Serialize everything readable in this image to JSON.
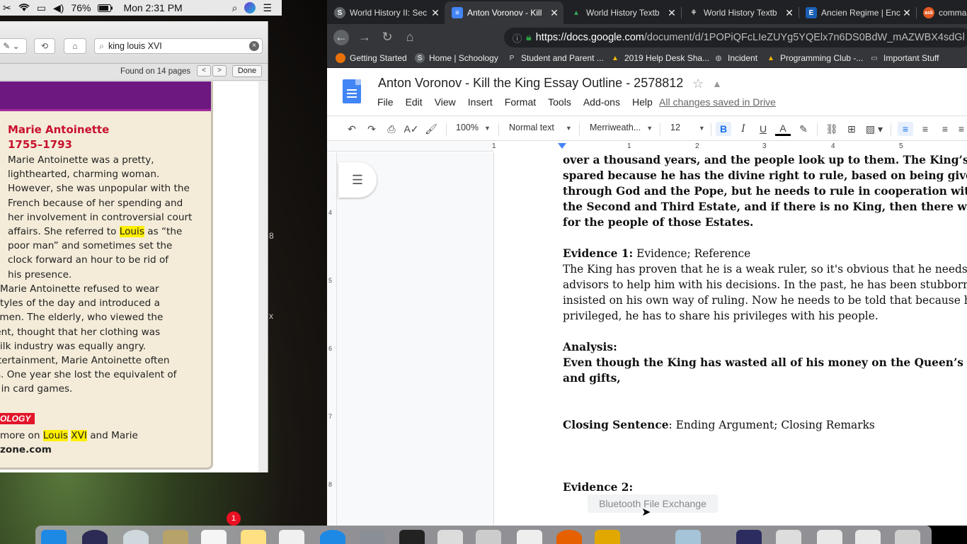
{
  "menubar": {
    "battery": "76%",
    "clock": "Mon 2:31 PM"
  },
  "preview": {
    "search_value": "king louis XVI",
    "found_text": "Found on 14 pages",
    "done_label": "Done",
    "prev_label": "<",
    "next_label": ">",
    "bio_name": "Marie Antoinette",
    "bio_years": "1755–1793",
    "para1_lines": [
      "Marie Antoinette was a pretty,",
      "lighthearted, charming woman.",
      "However, she was unpopular with the",
      "French because of her spending and",
      "her involvement in controversial court"
    ],
    "para1_line6_pre": "affairs. She referred to ",
    "para1_line6_hl": "Louis",
    "para1_line6_post": " as “the",
    "para1_tail": [
      "poor man” and sometimes set the",
      "clock forward an hour to be rid of",
      "his presence."
    ],
    "para2_lines": [
      "        Marie Antoinette refused to wear",
      "g styles of the day and introduced a",
      "women. The elderly, who viewed the",
      "ment, thought that her clothing was",
      "n silk industry was equally angry.",
      "entertainment, Marie Antoinette often",
      "rds. One year she lost the equivalent of",
      "ng in card games."
    ],
    "tech_label": "OLOGY",
    "tech_pre": "more on ",
    "tech_hl1": "Louis",
    "tech_hl2": "XVI",
    "tech_post": " and Marie",
    "tech_site": "zone.com",
    "side_digits": [
      "8",
      "x"
    ]
  },
  "tabs": [
    {
      "title": "World History II: Sec",
      "favicon": "S",
      "color": "#5f6368"
    },
    {
      "title": "Anton Voronov - Kill",
      "favicon": "≡",
      "color": "#4285f4"
    },
    {
      "title": "World History Textb",
      "favicon": "▲",
      "color": "#34a853"
    },
    {
      "title": "World History Textb",
      "favicon": "⚘",
      "color": "#5f6368"
    },
    {
      "title": "Ancien Regime | Enc",
      "favicon": "E",
      "color": "#1a5fb4"
    },
    {
      "title": "comma",
      "favicon": "ask",
      "color": "#e25822"
    }
  ],
  "url": {
    "host": "https://docs.google.com",
    "path": "/document/d/1POPiQFcLIeZUYg5YQElx7n6DS0BdW_mAZWBX4sdGl"
  },
  "bookmarks": [
    {
      "label": "Getting Started",
      "color": "#e8710a"
    },
    {
      "label": "Home | Schoology",
      "color": "#5f6368"
    },
    {
      "label": "Student and Parent ...",
      "color": "#5f6368"
    },
    {
      "label": "2019 Help Desk Sha...",
      "color": "#34a853"
    },
    {
      "label": "Incident",
      "color": "#5f6368"
    },
    {
      "label": "Programming Club -...",
      "color": "#34a853"
    },
    {
      "label": "Important Stuff",
      "color": "#5f6368"
    }
  ],
  "docs": {
    "title": "Anton Voronov - Kill the King Essay Outline - 2578812",
    "menu": [
      "File",
      "Edit",
      "View",
      "Insert",
      "Format",
      "Tools",
      "Add-ons",
      "Help"
    ],
    "saved": "All changes saved in Drive",
    "zoom": "100%",
    "style": "Normal text",
    "font": "Merriweath...",
    "size": "12",
    "ruler_nums": [
      "1",
      "1",
      "2",
      "3",
      "4",
      "5"
    ],
    "vruler_nums": [
      "4",
      "5",
      "6",
      "7",
      "8"
    ],
    "lines": {
      "l1": "over a thousand years, and the people look up to them. The King’s life sh",
      "l2": "spared because  he has the divine right to rule, based on being given the",
      "l3": "through God and the Pope, but he needs to rule in cooperation with men",
      "l4": "the Second and Third Estate, and if there is no King, then there will be n",
      "l5": "for the people of those Estates.",
      "ev1_label": "Evidence 1:",
      "ev1_rest": " Evidence; Reference",
      "ev1_body": [
        "The King has proven that he is a weak ruler, so it's obvious that he needs",
        "advisors to help him with his decisions. In the past, he has been stubborn",
        "insisted on his own way of ruling. Now he needs to be told that because h",
        "privileged, he has to share his privileges with his people."
      ],
      "analysis_label": "Analysis:",
      "analysis_body": [
        "Even though the King has wasted all of his money on the Queen’s clothe",
        "and gifts,"
      ],
      "closing_label": "Closing Sentence",
      "closing_rest": ": Ending Argument; Closing Remarks",
      "ev2_label": "Evidence 2:"
    },
    "tooltip": "Bluetooth File Exchange"
  },
  "dock": {
    "badge": "1"
  }
}
